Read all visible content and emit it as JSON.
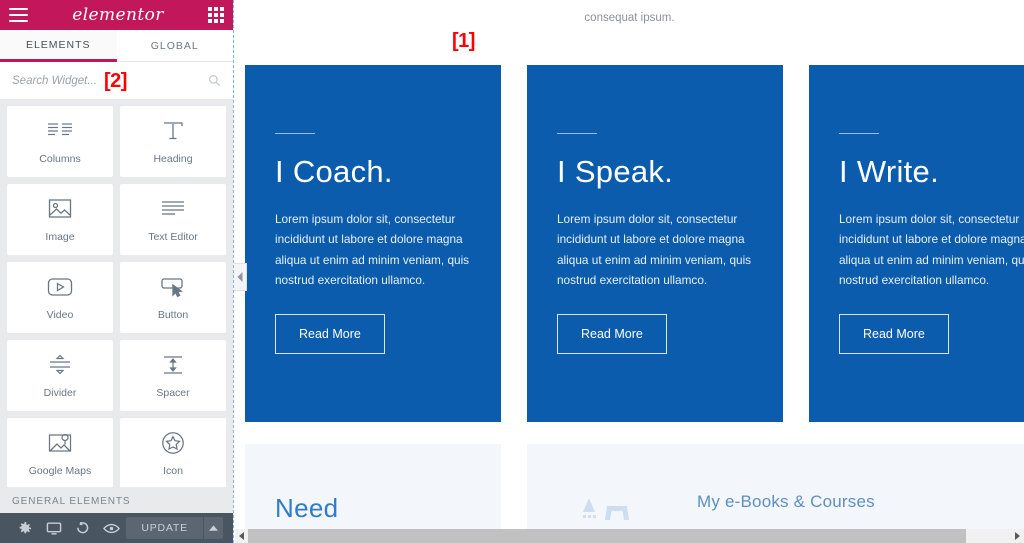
{
  "panel": {
    "header": {
      "menu_icon": "hamburger-icon",
      "brand": "elementor",
      "apps_icon": "grid-apps-icon"
    },
    "tabs": [
      {
        "label": "ELEMENTS",
        "active": true
      },
      {
        "label": "GLOBAL",
        "active": false
      }
    ],
    "search": {
      "placeholder": "Search Widget...",
      "value": "",
      "icon": "search-icon"
    },
    "widgets": [
      {
        "label": "Columns",
        "icon": "columns-icon"
      },
      {
        "label": "Heading",
        "icon": "heading-t-icon"
      },
      {
        "label": "Image",
        "icon": "image-icon"
      },
      {
        "label": "Text Editor",
        "icon": "text-lines-icon"
      },
      {
        "label": "Video",
        "icon": "video-play-icon"
      },
      {
        "label": "Button",
        "icon": "button-cursor-icon"
      },
      {
        "label": "Divider",
        "icon": "divider-icon"
      },
      {
        "label": "Spacer",
        "icon": "spacer-arrows-icon"
      },
      {
        "label": "Google Maps",
        "icon": "google-maps-icon"
      },
      {
        "label": "Icon",
        "icon": "star-circle-icon"
      }
    ],
    "section_title": "GENERAL ELEMENTS",
    "footer": {
      "settings_icon": "gear-icon",
      "responsive_icon": "monitor-icon",
      "history_icon": "history-revert-icon",
      "preview_icon": "eye-icon",
      "update_label": "UPDATE",
      "caret_icon": "chevron-up-icon"
    },
    "collapse_icon": "chevron-left-icon"
  },
  "canvas": {
    "top_note": "consequat ipsum.",
    "cards": [
      {
        "title": "I Coach.",
        "body": "Lorem ipsum dolor sit, consectetur incididunt ut labore et dolore magna aliqua ut enim ad minim veniam, quis nostrud exercitation ullamco.",
        "button": "Read More"
      },
      {
        "title": "I Speak.",
        "body": "Lorem ipsum dolor sit, consectetur incididunt ut labore et dolore magna aliqua ut enim ad minim veniam, quis nostrud exercitation ullamco.",
        "button": "Read More"
      },
      {
        "title": "I Write.",
        "body": "Lorem ipsum dolor sit, consectetur incididunt ut labore et dolore magna aliqua ut enim ad minim veniam, quis nostrud exercitation ullamco.",
        "button": "Read More"
      }
    ],
    "lower_left_heading": "Need",
    "lower_right_heading": "My e-Books & Courses",
    "scroll": {
      "left_arrow_icon": "caret-left-icon",
      "right_arrow_icon": "caret-right-icon"
    }
  },
  "markers": {
    "one": "[1]",
    "two": "[2]"
  },
  "colors": {
    "brand_pink": "#c2185b",
    "card_blue": "#0b5cad",
    "panel_grey": "#e8eaec",
    "footer_grey": "#4a5562",
    "marker_red": "#ff0000",
    "strip_blue_bg": "#f3f7fb"
  }
}
